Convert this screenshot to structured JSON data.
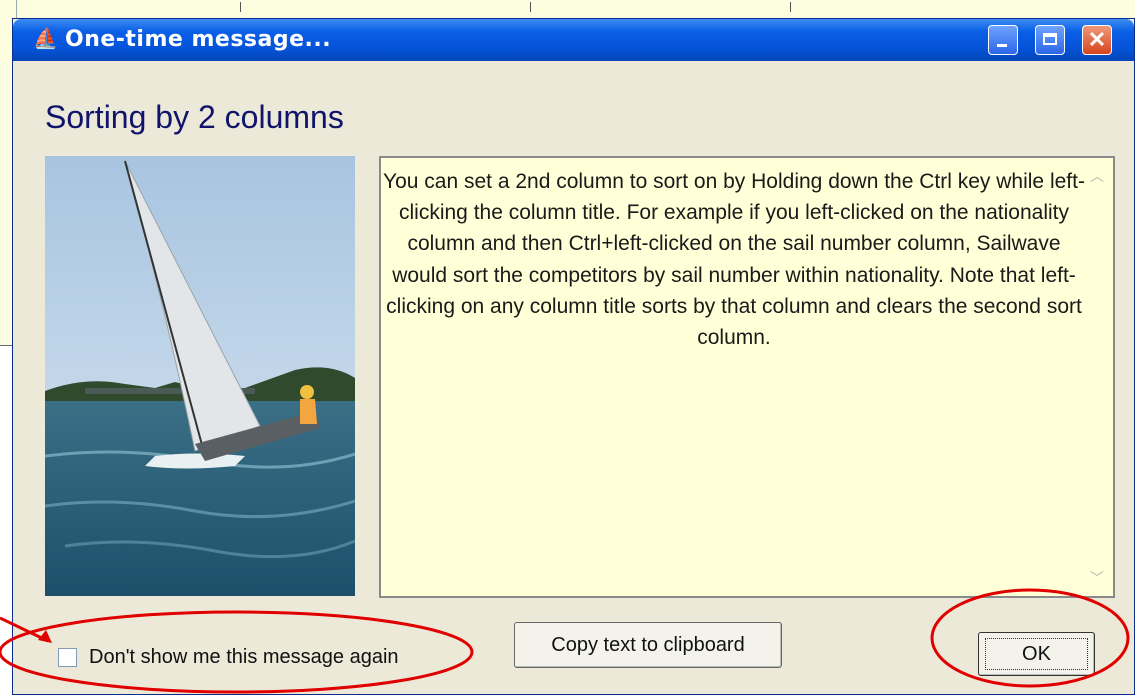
{
  "window": {
    "title": "One-time message...",
    "title_icon": "sailboat-icon",
    "heading": "Sorting by 2 columns"
  },
  "image": {
    "description_icon": "sailing-photo"
  },
  "message": {
    "text": "You can set a 2nd column to sort on by Holding down the Ctrl key while left-clicking the column title.  For example if you left-clicked on the nationality column and then Ctrl+left-clicked on the sail number column, Sailwave would sort the competitors by sail number within nationality.  Note that left-clicking on any column title sorts by that column and clears the second sort column."
  },
  "checkbox": {
    "label": "Don't show me this message again",
    "checked": false
  },
  "buttons": {
    "copy_label": "Copy text to clipboard",
    "ok_label": "OK"
  },
  "colors": {
    "titlebar": "#0553d8",
    "heading": "#10146a",
    "message_background": "#ffffd8",
    "annotation": "#e00000"
  }
}
